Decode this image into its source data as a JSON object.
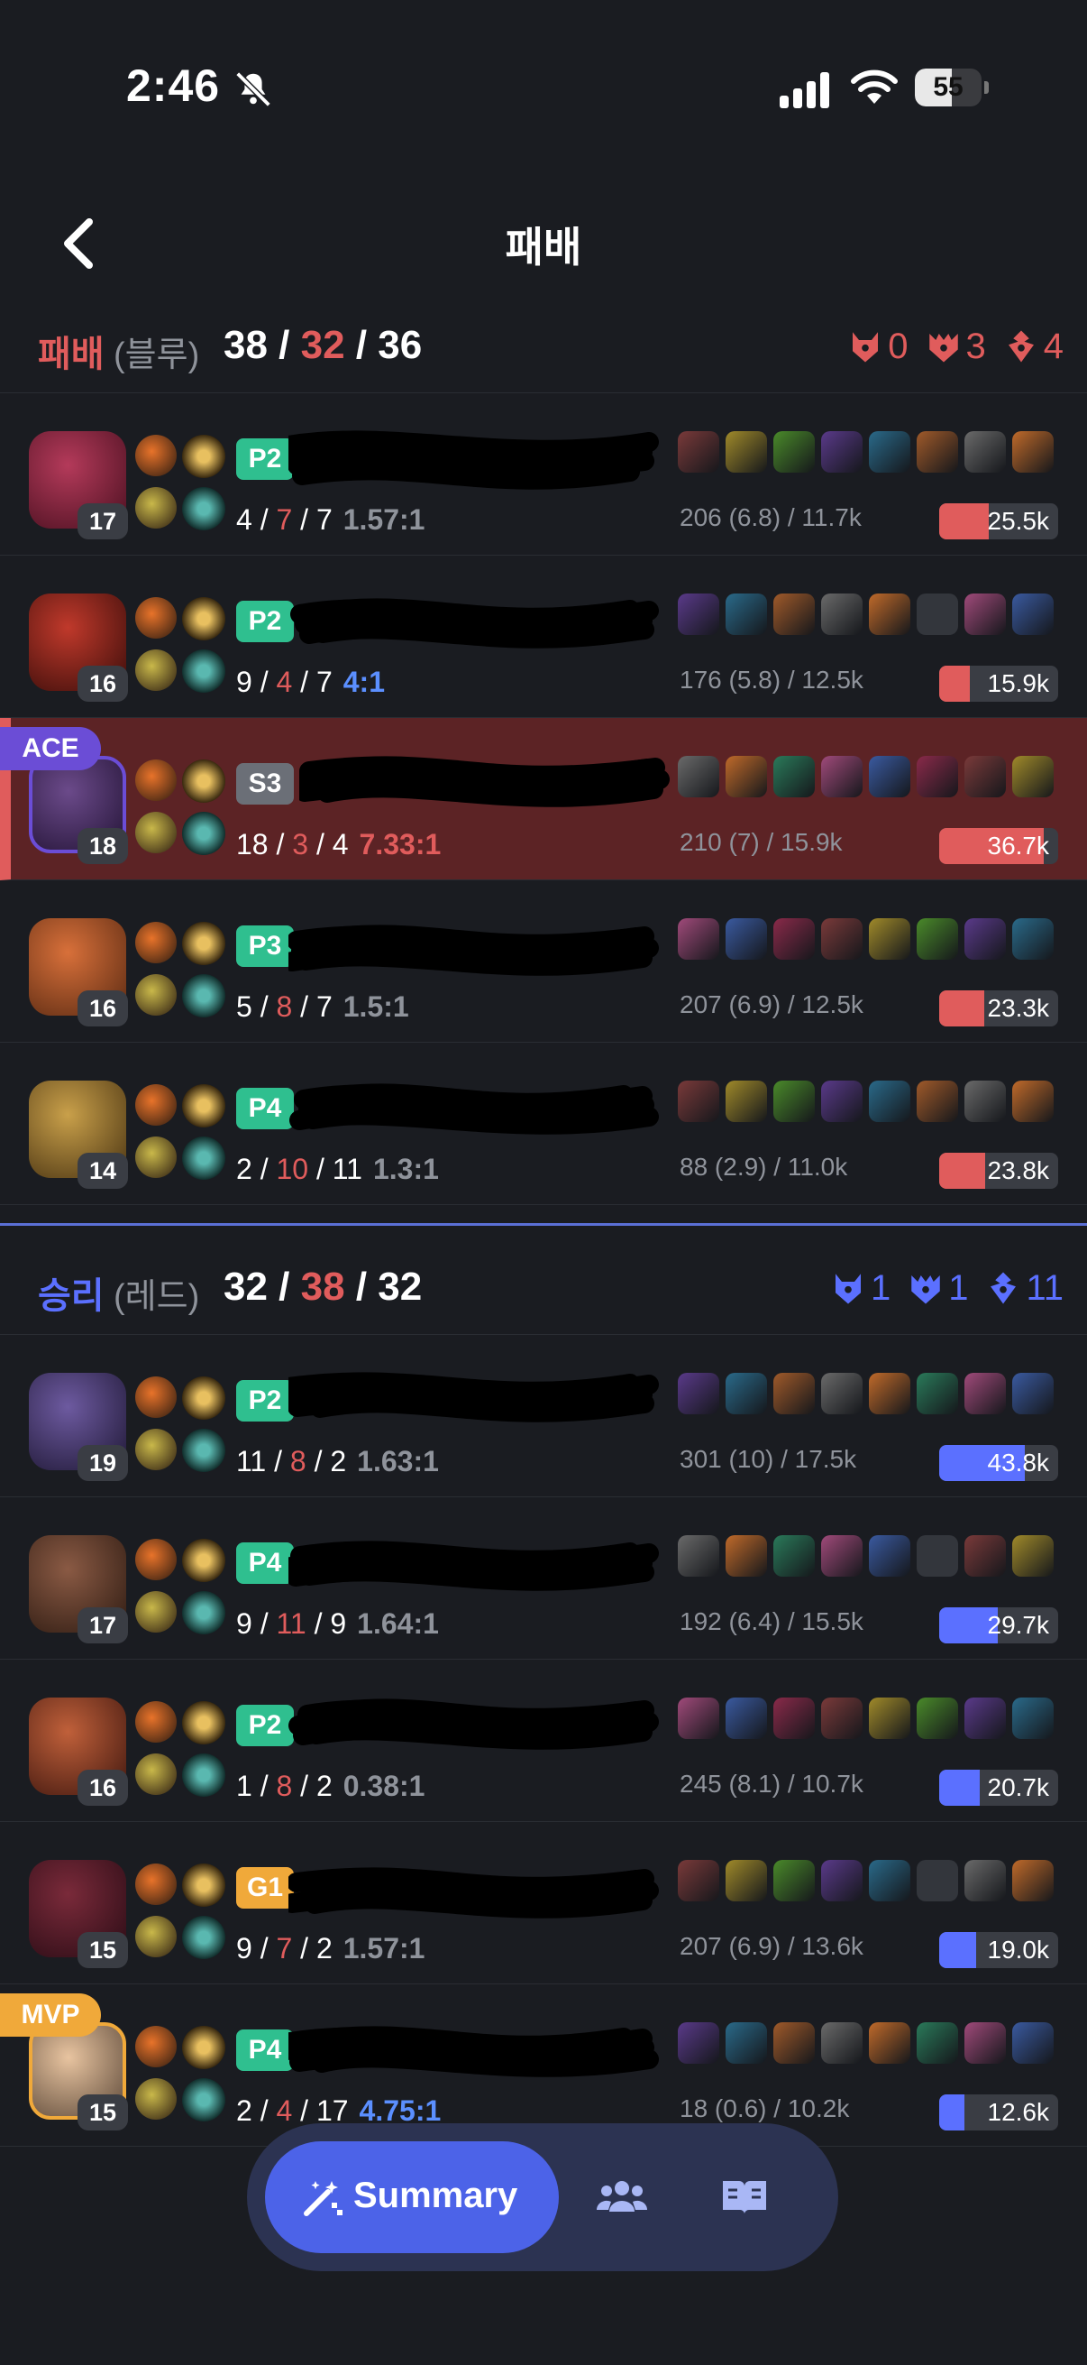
{
  "status_bar": {
    "time": "2:46",
    "battery": "55",
    "battery_level": 0.55
  },
  "nav": {
    "title": "패배"
  },
  "colors": {
    "red": "#e05c5c",
    "blue": "#5b70ff",
    "bg": "#1a1c21",
    "row_ace": "#5c2325",
    "tier_green": "#2fbf8f",
    "tier_gray": "#6b6f77",
    "tier_gold": "#f0a93a",
    "mvp": "#f0a93a",
    "ace": "#6b4dd6"
  },
  "teams": [
    {
      "result": "패배",
      "side": "(블루)",
      "kda": {
        "k": "38",
        "d": "32",
        "a": "36"
      },
      "objectives": {
        "baron": "0",
        "dragon": "3",
        "tower": "4"
      },
      "players": [
        {
          "level": "17",
          "tier": "P2",
          "kda": {
            "k": "4",
            "d": "7",
            "a": "7"
          },
          "ratio": "1.57:1",
          "cs": "206 (6.8) / 11.7k",
          "damage": "25.5k",
          "damage_share": 0.42
        },
        {
          "level": "16",
          "tier": "P2",
          "kda": {
            "k": "9",
            "d": "4",
            "a": "7"
          },
          "ratio": "4:1",
          "cs": "176 (5.8) / 12.5k",
          "damage": "15.9k",
          "damage_share": 0.26
        },
        {
          "level": "18",
          "tier": "S3",
          "kda": {
            "k": "18",
            "d": "3",
            "a": "4"
          },
          "ratio": "7.33:1",
          "cs": "210 (7) / 15.9k",
          "damage": "36.7k",
          "damage_share": 0.88,
          "badge": "ACE"
        },
        {
          "level": "16",
          "tier": "P3",
          "kda": {
            "k": "5",
            "d": "8",
            "a": "7"
          },
          "ratio": "1.5:1",
          "cs": "207 (6.9) / 12.5k",
          "damage": "23.3k",
          "damage_share": 0.38
        },
        {
          "level": "14",
          "tier": "P4",
          "kda": {
            "k": "2",
            "d": "10",
            "a": "11"
          },
          "ratio": "1.3:1",
          "cs": "88 (2.9) / 11.0k",
          "damage": "23.8k",
          "damage_share": 0.39
        }
      ]
    },
    {
      "result": "승리",
      "side": "(레드)",
      "kda": {
        "k": "32",
        "d": "38",
        "a": "32"
      },
      "objectives": {
        "baron": "1",
        "dragon": "1",
        "tower": "11"
      },
      "players": [
        {
          "level": "19",
          "tier": "P2",
          "kda": {
            "k": "11",
            "d": "8",
            "a": "2"
          },
          "ratio": "1.63:1",
          "cs": "301 (10) / 17.5k",
          "damage": "43.8k",
          "damage_share": 0.72
        },
        {
          "level": "17",
          "tier": "P4",
          "kda": {
            "k": "9",
            "d": "11",
            "a": "9"
          },
          "ratio": "1.64:1",
          "cs": "192 (6.4) / 15.5k",
          "damage": "29.7k",
          "damage_share": 0.49
        },
        {
          "level": "16",
          "tier": "P2",
          "kda": {
            "k": "1",
            "d": "8",
            "a": "2"
          },
          "ratio": "0.38:1",
          "cs": "245 (8.1) / 10.7k",
          "damage": "20.7k",
          "damage_share": 0.34
        },
        {
          "level": "15",
          "tier": "G1",
          "kda": {
            "k": "9",
            "d": "7",
            "a": "2"
          },
          "ratio": "1.57:1",
          "cs": "207 (6.9) / 13.6k",
          "damage": "19.0k",
          "damage_share": 0.31
        },
        {
          "level": "15",
          "tier": "P4",
          "kda": {
            "k": "2",
            "d": "4",
            "a": "17"
          },
          "ratio": "4.75:1",
          "cs": "18 (0.6) / 10.2k",
          "damage": "12.6k",
          "damage_share": 0.21,
          "badge": "MVP"
        }
      ]
    }
  ],
  "bottom_nav": {
    "summary_label": "Summary",
    "tabs": [
      "team-icon",
      "guide-book-icon"
    ]
  }
}
